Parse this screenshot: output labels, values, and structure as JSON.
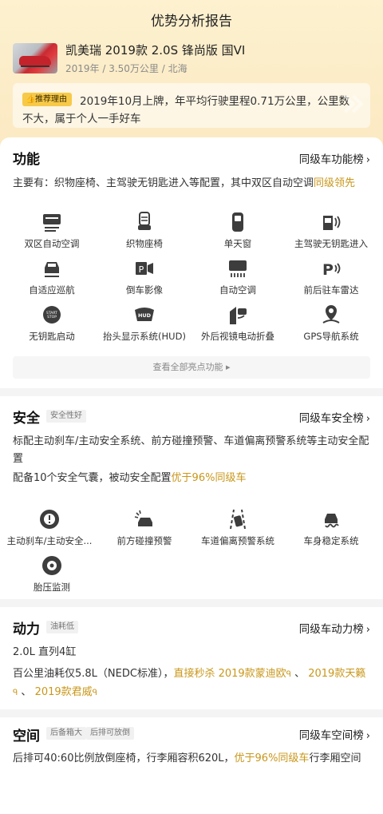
{
  "page": {
    "title": "优势分析报告"
  },
  "car": {
    "name": "凯美瑞 2019款 2.0S 锋尚版 国VI",
    "meta": "2019年 / 3.50万公里 / 北海"
  },
  "reason": {
    "badge": "推荐理由",
    "text": "2019年10月上牌，年平均行驶里程0.71万公里，公里数不大，属于个人一手好车"
  },
  "function": {
    "title": "功能",
    "rank_label": "同级车功能榜",
    "summary_prefix": "主要有：织物座椅、主驾驶无钥匙进入等配置，其中双区自动空调",
    "summary_highlight": "同级领先",
    "items": [
      {
        "label": "双区自动空调",
        "icon": "dual-ac-icon"
      },
      {
        "label": "织物座椅",
        "icon": "seat-icon"
      },
      {
        "label": "单天窗",
        "icon": "sunroof-icon"
      },
      {
        "label": "主驾驶无钥匙进入",
        "icon": "keyless-entry-icon"
      },
      {
        "label": "自适应巡航",
        "icon": "adaptive-cruise-icon"
      },
      {
        "label": "倒车影像",
        "icon": "reverse-camera-icon"
      },
      {
        "label": "自动空调",
        "icon": "auto-ac-icon"
      },
      {
        "label": "前后驻车雷达",
        "icon": "parking-radar-icon"
      },
      {
        "label": "无钥匙启动",
        "icon": "start-stop-icon"
      },
      {
        "label": "抬头显示系统(HUD)",
        "icon": "hud-icon"
      },
      {
        "label": "外后视镜电动折叠",
        "icon": "mirror-fold-icon"
      },
      {
        "label": "GPS导航系统",
        "icon": "gps-icon"
      }
    ],
    "show_all": "查看全部亮点功能 ▸"
  },
  "safety": {
    "title": "安全",
    "tag": "安全性好",
    "rank_label": "同级车安全榜",
    "line1": "标配主动刹车/主动安全系统、前方碰撞预警、车道偏离预警系统等主动安全配置",
    "line2_prefix": "配备10个安全气囊，被动安全配置",
    "line2_highlight": "优于96%同级车",
    "items": [
      {
        "label": "主动刹车/主动安全...",
        "icon": "active-brake-icon"
      },
      {
        "label": "前方碰撞预警",
        "icon": "collision-warning-icon"
      },
      {
        "label": "车道偏离预警系统",
        "icon": "lane-departure-icon"
      },
      {
        "label": "车身稳定系统",
        "icon": "stability-icon"
      },
      {
        "label": "胎压监测",
        "icon": "tire-pressure-icon"
      }
    ]
  },
  "power": {
    "title": "动力",
    "tag": "油耗低",
    "rank_label": "同级车动力榜",
    "engine": "2.0L 直列4缸",
    "fuel_prefix": "百公里油耗仅5.8L（NEDC标准），",
    "fuel_hl1": "直接秒杀 2019款蒙迪欧",
    "sep1": " 、 ",
    "fuel_hl2": "2019款天籁",
    "sep2": " 、 ",
    "fuel_hl3": "2019款君威"
  },
  "space": {
    "title": "空间",
    "tags": [
      "后备箱大",
      "后排可放倒"
    ],
    "rank_label": "同级车空间榜",
    "text_prefix": "后排可40:60比例放倒座椅，行李厢容积620L，",
    "text_highlight": "优于96%同级车",
    "text_suffix": "行李厢空间"
  },
  "colors": {
    "accent": "#c9971a",
    "badge": "#f7c948",
    "header_bg": "#fdf1cf"
  }
}
